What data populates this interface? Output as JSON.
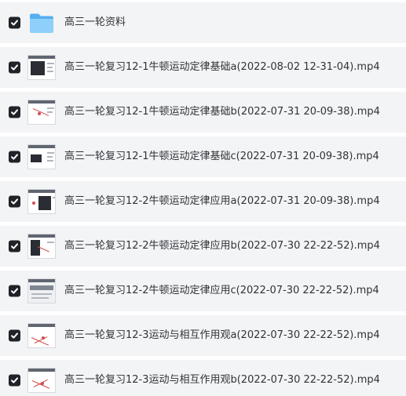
{
  "items": [
    {
      "type": "folder",
      "name": "高三一轮资料",
      "checked": true,
      "icon": "folder-icon"
    },
    {
      "type": "video",
      "name": "高三一轮复习12-1牛顿运动定律基础a(2022-08-02 12-31-04).mp4",
      "checked": true,
      "icon": "video-thumbnail-icon"
    },
    {
      "type": "video",
      "name": "高三一轮复习12-1牛顿运动定律基础b(2022-07-31 20-09-38).mp4",
      "checked": true,
      "icon": "video-thumbnail-icon"
    },
    {
      "type": "video",
      "name": "高三一轮复习12-1牛顿运动定律基础c(2022-07-31 20-09-38).mp4",
      "checked": true,
      "icon": "video-thumbnail-icon"
    },
    {
      "type": "video",
      "name": "高三一轮复习12-2牛顿运动定律应用a(2022-07-31 20-09-38).mp4",
      "checked": true,
      "icon": "video-thumbnail-icon"
    },
    {
      "type": "video",
      "name": "高三一轮复习12-2牛顿运动定律应用b(2022-07-30 22-22-52).mp4",
      "checked": true,
      "icon": "video-thumbnail-icon"
    },
    {
      "type": "video",
      "name": "高三一轮复习12-2牛顿运动定律应用c(2022-07-30 22-22-52).mp4",
      "checked": true,
      "icon": "video-thumbnail-icon"
    },
    {
      "type": "video",
      "name": "高三一轮复习12-3运动与相互作用观a(2022-07-30 22-22-52).mp4",
      "checked": true,
      "icon": "video-thumbnail-icon"
    },
    {
      "type": "video",
      "name": "高三一轮复习12-3运动与相互作用观b(2022-07-30 22-22-52).mp4",
      "checked": true,
      "icon": "video-thumbnail-icon"
    }
  ],
  "colors": {
    "row_background": "#f3f4f6",
    "checkbox": "#1f2328",
    "text": "#2f3337",
    "folder": "#7cc4f7"
  }
}
